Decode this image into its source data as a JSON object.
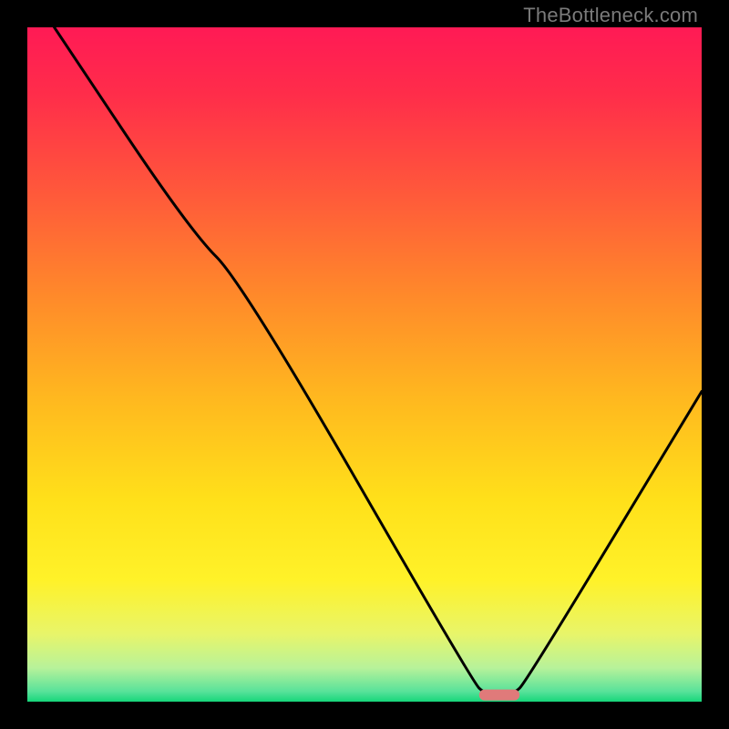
{
  "watermark": "TheBottleneck.com",
  "chart_data": {
    "type": "line",
    "title": "",
    "xlabel": "",
    "ylabel": "",
    "xlim": [
      0,
      100
    ],
    "ylim": [
      0,
      100
    ],
    "curve": [
      {
        "x": 4,
        "y": 100
      },
      {
        "x": 24,
        "y": 70
      },
      {
        "x": 32,
        "y": 62
      },
      {
        "x": 66,
        "y": 3
      },
      {
        "x": 68,
        "y": 1
      },
      {
        "x": 72,
        "y": 1
      },
      {
        "x": 74,
        "y": 3
      },
      {
        "x": 100,
        "y": 46
      }
    ],
    "marker": {
      "x_center": 70,
      "y": 1,
      "width": 6,
      "color": "#e07a7a"
    },
    "gradient_stops": [
      {
        "offset": 0.0,
        "color": "#ff1a55"
      },
      {
        "offset": 0.1,
        "color": "#ff2d4a"
      },
      {
        "offset": 0.25,
        "color": "#ff5a3a"
      },
      {
        "offset": 0.4,
        "color": "#ff8a2a"
      },
      {
        "offset": 0.55,
        "color": "#ffb81f"
      },
      {
        "offset": 0.7,
        "color": "#ffe01a"
      },
      {
        "offset": 0.82,
        "color": "#fff229"
      },
      {
        "offset": 0.9,
        "color": "#e8f56a"
      },
      {
        "offset": 0.95,
        "color": "#b7f29a"
      },
      {
        "offset": 0.985,
        "color": "#58e29a"
      },
      {
        "offset": 1.0,
        "color": "#16d67a"
      }
    ]
  }
}
